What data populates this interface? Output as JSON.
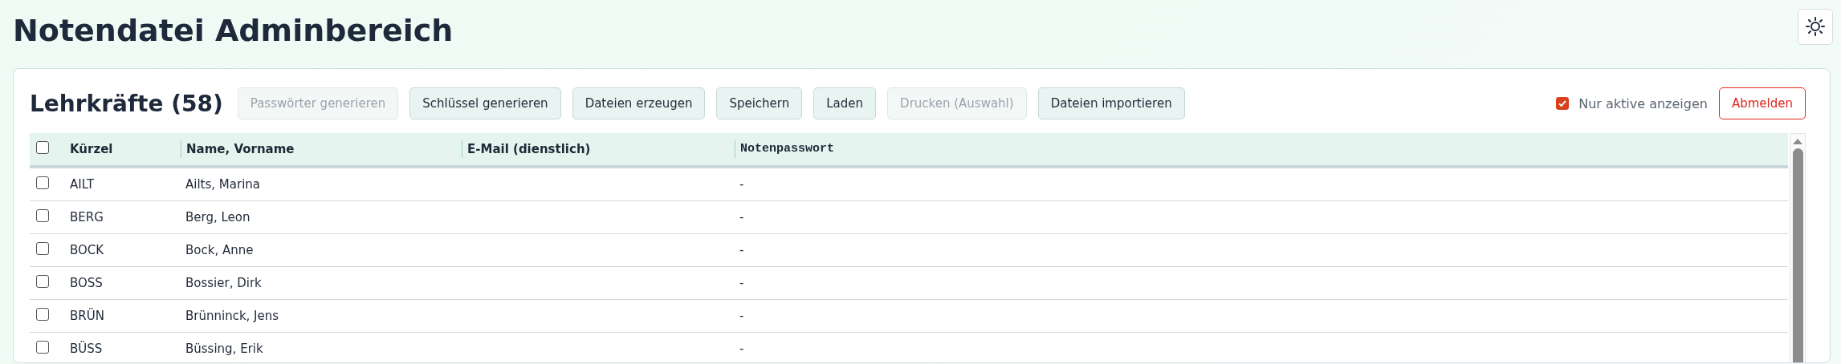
{
  "page": {
    "title": "Notendatei Adminbereich"
  },
  "panel": {
    "heading": "Lehrkräfte (58)",
    "buttons": [
      {
        "label": "Passwörter generieren",
        "disabled": true
      },
      {
        "label": "Schlüssel generieren",
        "disabled": false
      },
      {
        "label": "Dateien erzeugen",
        "disabled": false
      },
      {
        "label": "Speichern",
        "disabled": false
      },
      {
        "label": "Laden",
        "disabled": false
      },
      {
        "label": "Drucken (Auswahl)",
        "disabled": true
      },
      {
        "label": "Dateien importieren",
        "disabled": false
      }
    ],
    "filter": {
      "label": "Nur aktive anzeigen",
      "checked": true
    },
    "logout": {
      "label": "Abmelden"
    }
  },
  "table": {
    "select_all": {
      "checked": false
    },
    "columns": [
      {
        "label": "Kürzel",
        "kind": "text"
      },
      {
        "label": "Name, Vorname",
        "kind": "text"
      },
      {
        "label": "E-Mail (dienstlich)",
        "kind": "text"
      },
      {
        "label": "Notenpasswort",
        "kind": "mono"
      }
    ],
    "rows": [
      {
        "selected": false,
        "cells": [
          "AILT",
          "Ailts, Marina",
          "",
          "-"
        ]
      },
      {
        "selected": false,
        "cells": [
          "BERG",
          "Berg, Leon",
          "",
          "-"
        ]
      },
      {
        "selected": false,
        "cells": [
          "BOCK",
          "Bock, Anne",
          "",
          "-"
        ]
      },
      {
        "selected": false,
        "cells": [
          "BOSS",
          "Bossier, Dirk",
          "",
          "-"
        ]
      },
      {
        "selected": false,
        "cells": [
          "BRÜN",
          "Brünninck, Jens",
          "",
          "-"
        ]
      },
      {
        "selected": false,
        "cells": [
          "BÜSS",
          "Büssing, Erik",
          "",
          "-"
        ]
      }
    ]
  }
}
